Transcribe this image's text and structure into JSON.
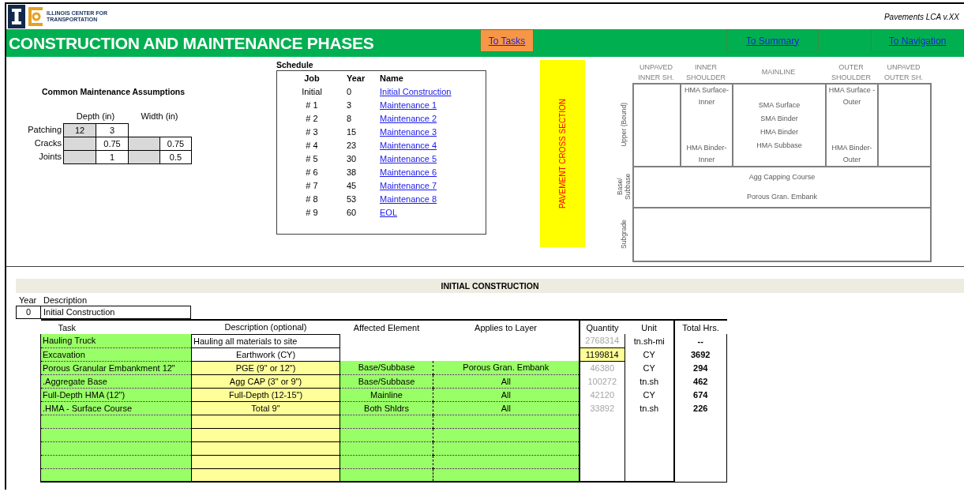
{
  "header": {
    "org_name": [
      "ILLINOIS CENTER FOR",
      "TRANSPORTATION"
    ],
    "version": "Pavements LCA v.XX",
    "title": "CONSTRUCTION AND MAINTENANCE PHASES",
    "nav_buttons": [
      {
        "label": "To Tasks",
        "kind": "orange"
      },
      {
        "label": "To Summary",
        "kind": "green"
      },
      {
        "label": "To Navigation",
        "kind": "green"
      }
    ]
  },
  "maintenance": {
    "title": "Common Maintenance Assumptions",
    "column_headers": [
      "Depth (in)",
      "Width (in)"
    ],
    "rows": [
      {
        "label": "Patching",
        "cells": [
          {
            "value": "12",
            "kind": "grey"
          },
          {
            "value": "3",
            "kind": "white"
          },
          {
            "kind": "none"
          },
          {
            "kind": "none"
          }
        ]
      },
      {
        "label": "Cracks",
        "cells": [
          {
            "kind": "grey"
          },
          {
            "value": "0.75",
            "kind": "white"
          },
          {
            "kind": "grey"
          },
          {
            "value": "0.75",
            "kind": "white"
          }
        ]
      },
      {
        "label": "Joints",
        "cells": [
          {
            "kind": "grey"
          },
          {
            "value": "1",
            "kind": "white"
          },
          {
            "kind": "grey"
          },
          {
            "value": "0.5",
            "kind": "white"
          }
        ]
      }
    ]
  },
  "schedule": {
    "title": "Schedule",
    "columns": [
      "Job",
      "Year",
      "Name"
    ],
    "rows": [
      {
        "job": "Initial",
        "year": "0",
        "name": "Initial Construction"
      },
      {
        "job": "# 1",
        "year": "3",
        "name": "Maintenance 1"
      },
      {
        "job": "# 2",
        "year": "8",
        "name": "Maintenance 2"
      },
      {
        "job": "# 3",
        "year": "15",
        "name": "Maintenance 3"
      },
      {
        "job": "# 4",
        "year": "23",
        "name": "Maintenance 4"
      },
      {
        "job": "# 5",
        "year": "30",
        "name": "Maintenance 5"
      },
      {
        "job": "# 6",
        "year": "38",
        "name": "Maintenance 6"
      },
      {
        "job": "# 7",
        "year": "45",
        "name": "Maintenance 7"
      },
      {
        "job": "# 8",
        "year": "53",
        "name": "Maintenance 8"
      },
      {
        "job": "# 9",
        "year": "60",
        "name": "EOL"
      }
    ]
  },
  "cross_section": {
    "label": "PAVEMENT CROSS SECTION",
    "columns": [
      "UNPAVED INNER SH.",
      "INNER SHOULDER",
      "MAINLINE",
      "OUTER SHOULDER",
      "UNPAVED OUTER SH."
    ],
    "upper": {
      "label": "Upper (Bound)",
      "cells": [
        {},
        {
          "top": "HMA Surface-Inner",
          "bottom": "HMA Binder-Inner"
        },
        {
          "middle": [
            "SMA Surface",
            "SMA Binder",
            "HMA Binder",
            "HMA Subbase"
          ]
        },
        {
          "top": "HMA Surface -Outer",
          "bottom": "HMA Binder-Outer"
        },
        {}
      ]
    },
    "base": {
      "label": "Base/ Subbase",
      "lines": [
        "Agg Capping Course",
        "Porous Gran. Embank"
      ]
    },
    "subgrade": {
      "label": "Subgrade"
    }
  },
  "initial": {
    "title": "INITIAL CONSTRUCTION",
    "year_label": "Year",
    "description_label": "Description",
    "year": "0",
    "description": "Initial Construction",
    "columns": [
      "Task",
      "Description (optional)",
      "Affected Element",
      "Applies to Layer",
      "Quantity",
      "Unit",
      "Total Hrs."
    ],
    "rows": [
      {
        "kind": "general",
        "task": "Hauling Truck",
        "description": "Hauling all materials to site",
        "quantity": "2768314",
        "quantity_input": false,
        "unit": "tn.sh-mi",
        "hours": "--"
      },
      {
        "kind": "general",
        "task": "Excavation",
        "description": "Earthwork (CY)",
        "quantity": "1199814",
        "quantity_input": true,
        "unit": "CY",
        "hours": "3692"
      },
      {
        "kind": "layer",
        "task": "Porous Granular Embankment 12\"",
        "description": "PGE (9\" or 12\")",
        "element": "Base/Subbase",
        "layer": "Porous Gran. Embank",
        "quantity": "46380",
        "quantity_input": false,
        "unit": "CY",
        "hours": "294"
      },
      {
        "kind": "layer",
        "task": ".Aggregate Base",
        "description": "Agg CAP (3\" or 9\")",
        "element": "Base/Subbase",
        "layer": "All",
        "quantity": "100272",
        "quantity_input": false,
        "unit": "tn.sh",
        "hours": "462"
      },
      {
        "kind": "layer",
        "task": "Full-Depth HMA (12\")",
        "description": "Full-Depth (12-15\")",
        "element": "Mainline",
        "layer": "All",
        "quantity": "42120",
        "quantity_input": false,
        "unit": "CY",
        "hours": "674"
      },
      {
        "kind": "layer",
        "task": ".HMA - Surface Course",
        "description": "Total 9\"",
        "element": "Both Shldrs",
        "layer": "All",
        "quantity": "33892",
        "quantity_input": false,
        "unit": "tn.sh",
        "hours": "226"
      },
      {
        "kind": "blank"
      },
      {
        "kind": "blank"
      },
      {
        "kind": "blank"
      },
      {
        "kind": "blank"
      },
      {
        "kind": "blank"
      }
    ]
  }
}
